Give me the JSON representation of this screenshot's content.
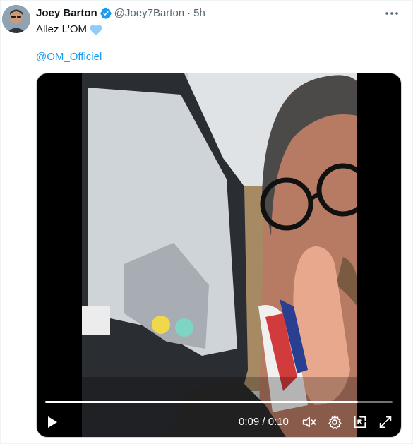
{
  "tweet": {
    "author_name": "Joey Barton",
    "handle": "@Joey7Barton",
    "separator": "·",
    "time": "5h",
    "text": "Allez L'OM",
    "emoji": "light-blue-heart",
    "mention": "@OM_Officiel"
  },
  "video": {
    "timecode": "0:09 / 0:10",
    "progress_fraction": 0.9
  },
  "colors": {
    "link": "#1d9bf0",
    "verified": "#1d9bf0",
    "secondary_text": "#536471",
    "heart": "#8ecdf8"
  },
  "icons": {
    "verified": "verified-badge-icon",
    "more": "more-options-icon",
    "play": "play-icon",
    "mute": "muted-speaker-icon",
    "settings": "gear-icon",
    "pip": "picture-in-picture-icon",
    "fullscreen": "fullscreen-icon"
  }
}
